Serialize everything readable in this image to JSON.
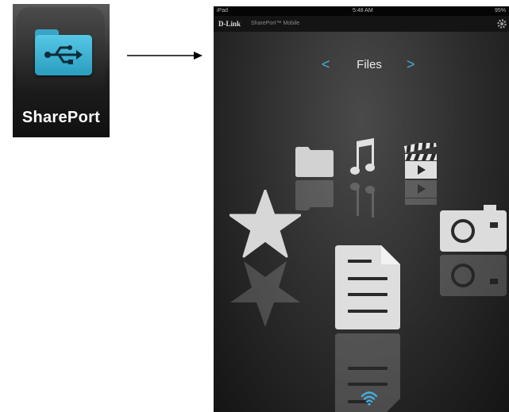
{
  "launcher": {
    "app_label": "SharePort",
    "icon": "usb-folder-icon"
  },
  "arrow_icon": "arrow-right-icon",
  "device": {
    "status_bar": {
      "carrier": "iPad",
      "time": "5:48 AM",
      "battery": "95%"
    },
    "header": {
      "brand": "D-Link",
      "app_name": "SharePort™ Mobile",
      "settings_icon": "gear-icon"
    },
    "nav": {
      "prev_symbol": "<",
      "title": "Files",
      "next_symbol": ">"
    },
    "categories": [
      {
        "name": "folder",
        "icon": "folder-icon"
      },
      {
        "name": "music",
        "icon": "music-note-icon"
      },
      {
        "name": "video",
        "icon": "clapperboard-icon"
      },
      {
        "name": "favorites",
        "icon": "star-icon"
      },
      {
        "name": "documents",
        "icon": "document-icon"
      },
      {
        "name": "photos",
        "icon": "camera-icon"
      }
    ],
    "connection_icon": "wifi-icon",
    "colors": {
      "accent": "#44aee0",
      "app_icon": "#3fb4d6"
    }
  }
}
